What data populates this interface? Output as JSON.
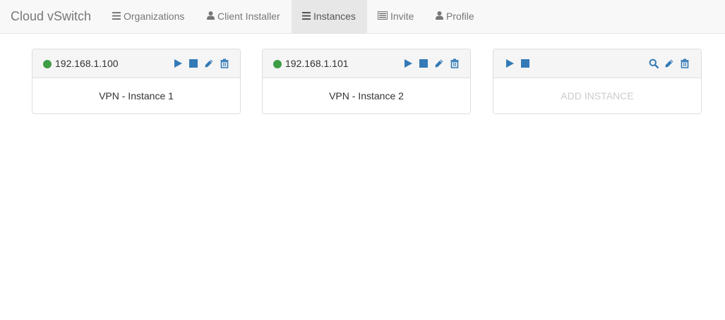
{
  "app": {
    "brand": "Cloud vSwitch"
  },
  "nav": {
    "items": [
      {
        "label": "Organizations",
        "icon": "list-icon",
        "active": false
      },
      {
        "label": "Client Installer",
        "icon": "user-icon",
        "active": false
      },
      {
        "label": "Instances",
        "icon": "list-icon",
        "active": true
      },
      {
        "label": "Invite",
        "icon": "list-alt-icon",
        "active": false
      },
      {
        "label": "Profile",
        "icon": "user-icon",
        "active": false
      }
    ]
  },
  "colors": {
    "accent": "#337ab7",
    "status_online": "#3e9e44",
    "placeholder_text": "#cccccc"
  },
  "instances": [
    {
      "ip": "192.168.1.100",
      "status": "online",
      "name": "VPN - Instance 1"
    },
    {
      "ip": "192.168.1.101",
      "status": "online",
      "name": "VPN - Instance 2"
    }
  ],
  "new_instance": {
    "label": "ADD INSTANCE"
  }
}
